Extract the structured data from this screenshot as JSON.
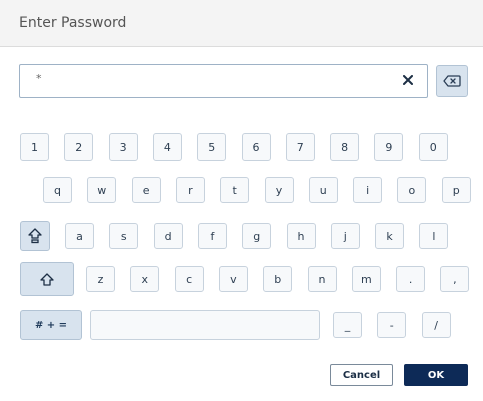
{
  "dialog": {
    "title": "Enter Password"
  },
  "password_field": {
    "value": "*",
    "clear_label": "×"
  },
  "keyboard": {
    "numbers": [
      "1",
      "2",
      "3",
      "4",
      "5",
      "6",
      "7",
      "8",
      "9",
      "0"
    ],
    "row_q": [
      "q",
      "w",
      "e",
      "r",
      "t",
      "y",
      "u",
      "i",
      "o",
      "p"
    ],
    "row_a": [
      "a",
      "s",
      "d",
      "f",
      "g",
      "h",
      "j",
      "k",
      "l"
    ],
    "row_z": [
      "z",
      "x",
      "c",
      "v",
      "b",
      "n",
      "m",
      ".",
      ","
    ],
    "symbols_label": "# + =",
    "bottom": [
      "_",
      "-",
      "/"
    ]
  },
  "actions": {
    "cancel": "Cancel",
    "ok": "OK"
  },
  "colors": {
    "accent": "#0d2a57",
    "key_bg": "#f7f9fb",
    "modifier_bg": "#d8e3ee"
  }
}
